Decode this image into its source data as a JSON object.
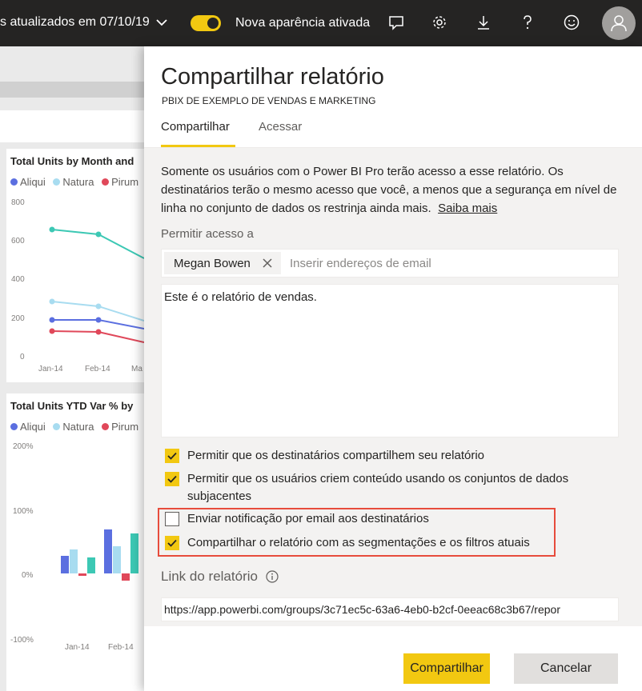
{
  "topbar": {
    "data_updated": "s atualizados em 07/10/19",
    "toggle_label": "Nova aparência ativada",
    "colors": {
      "bar": "#252423",
      "toggle": "#f2c811"
    },
    "icons": [
      "comment-icon",
      "gear-icon",
      "download-icon",
      "help-icon",
      "smiley-icon",
      "user-icon"
    ]
  },
  "background_report": {
    "chart1": {
      "title": "Total Units by Month and",
      "legend": [
        "Aliqui",
        "Natura",
        "Pirum"
      ],
      "yticks": [
        "800",
        "600",
        "400",
        "200",
        "0"
      ],
      "xticks": [
        "Jan-14",
        "Feb-14",
        "Ma"
      ]
    },
    "chart2": {
      "title": "Total Units YTD Var % by",
      "legend": [
        "Aliqui",
        "Natura",
        "Pirum"
      ],
      "yticks": [
        "200%",
        "100%",
        "0%",
        "-100%"
      ],
      "xticks": [
        "Jan-14",
        "Feb-14"
      ]
    },
    "colors": {
      "aliqui": "#5b6fe0",
      "natura": "#a8dcf0",
      "pirum": "#e0485a",
      "teal": "#3cc8b4"
    }
  },
  "dialog": {
    "title": "Compartilhar relatório",
    "subtitle": "PBIX DE EXEMPLO DE VENDAS E MARKETING",
    "tabs": [
      {
        "label": "Compartilhar",
        "active": true
      },
      {
        "label": "Acessar",
        "active": false
      }
    ],
    "info_text": "Somente os usuários com o Power BI Pro terão acesso a esse relatório. Os destinatários terão o mesmo acesso que você, a menos que a segurança em nível de linha no conjunto de dados os restrinja ainda mais.",
    "learn_more": "Saiba mais",
    "access_label": "Permitir acesso a",
    "recipient": "Megan Bowen",
    "email_placeholder": "Inserir endereços de email",
    "message": "Este é o relatório de vendas.",
    "options": [
      {
        "label": "Permitir que os destinatários compartilhem seu relatório",
        "checked": true
      },
      {
        "label": "Permitir que os usuários criem conteúdo usando os conjuntos de dados subjacentes",
        "checked": true
      },
      {
        "label": "Enviar notificação por email aos destinatários",
        "checked": false
      },
      {
        "label": "Compartilhar o relatório com as segmentações e os filtros atuais",
        "checked": true
      }
    ],
    "link_label": "Link do relatório",
    "link_url": "https://app.powerbi.com/groups/3c71ec5c-63a6-4eb0-b2cf-0eeac68c3b67/repor",
    "share_button": "Compartilhar",
    "cancel_button": "Cancelar"
  }
}
